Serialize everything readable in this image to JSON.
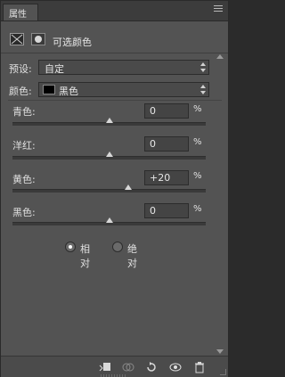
{
  "panel": {
    "tab_label": "属性",
    "title": "可选颜色"
  },
  "preset": {
    "label": "预设:",
    "value": "自定"
  },
  "color": {
    "label": "颜色:",
    "value": "黑色",
    "swatch": "#000000"
  },
  "sliders": [
    {
      "label": "青色:",
      "value": "0",
      "unit": "%",
      "fraction": 0.5
    },
    {
      "label": "洋红:",
      "value": "0",
      "unit": "%",
      "fraction": 0.5
    },
    {
      "label": "黄色:",
      "value": "+20",
      "unit": "%",
      "fraction": 0.6
    },
    {
      "label": "黑色:",
      "value": "0",
      "unit": "%",
      "fraction": 0.5
    }
  ],
  "method": {
    "relative_label": "相对",
    "absolute_label": "绝对",
    "selected": "relative"
  },
  "footer_icons": [
    "clip-to-layer-icon",
    "view-previous-state-icon",
    "reset-icon",
    "visibility-eye-icon",
    "trash-icon"
  ]
}
